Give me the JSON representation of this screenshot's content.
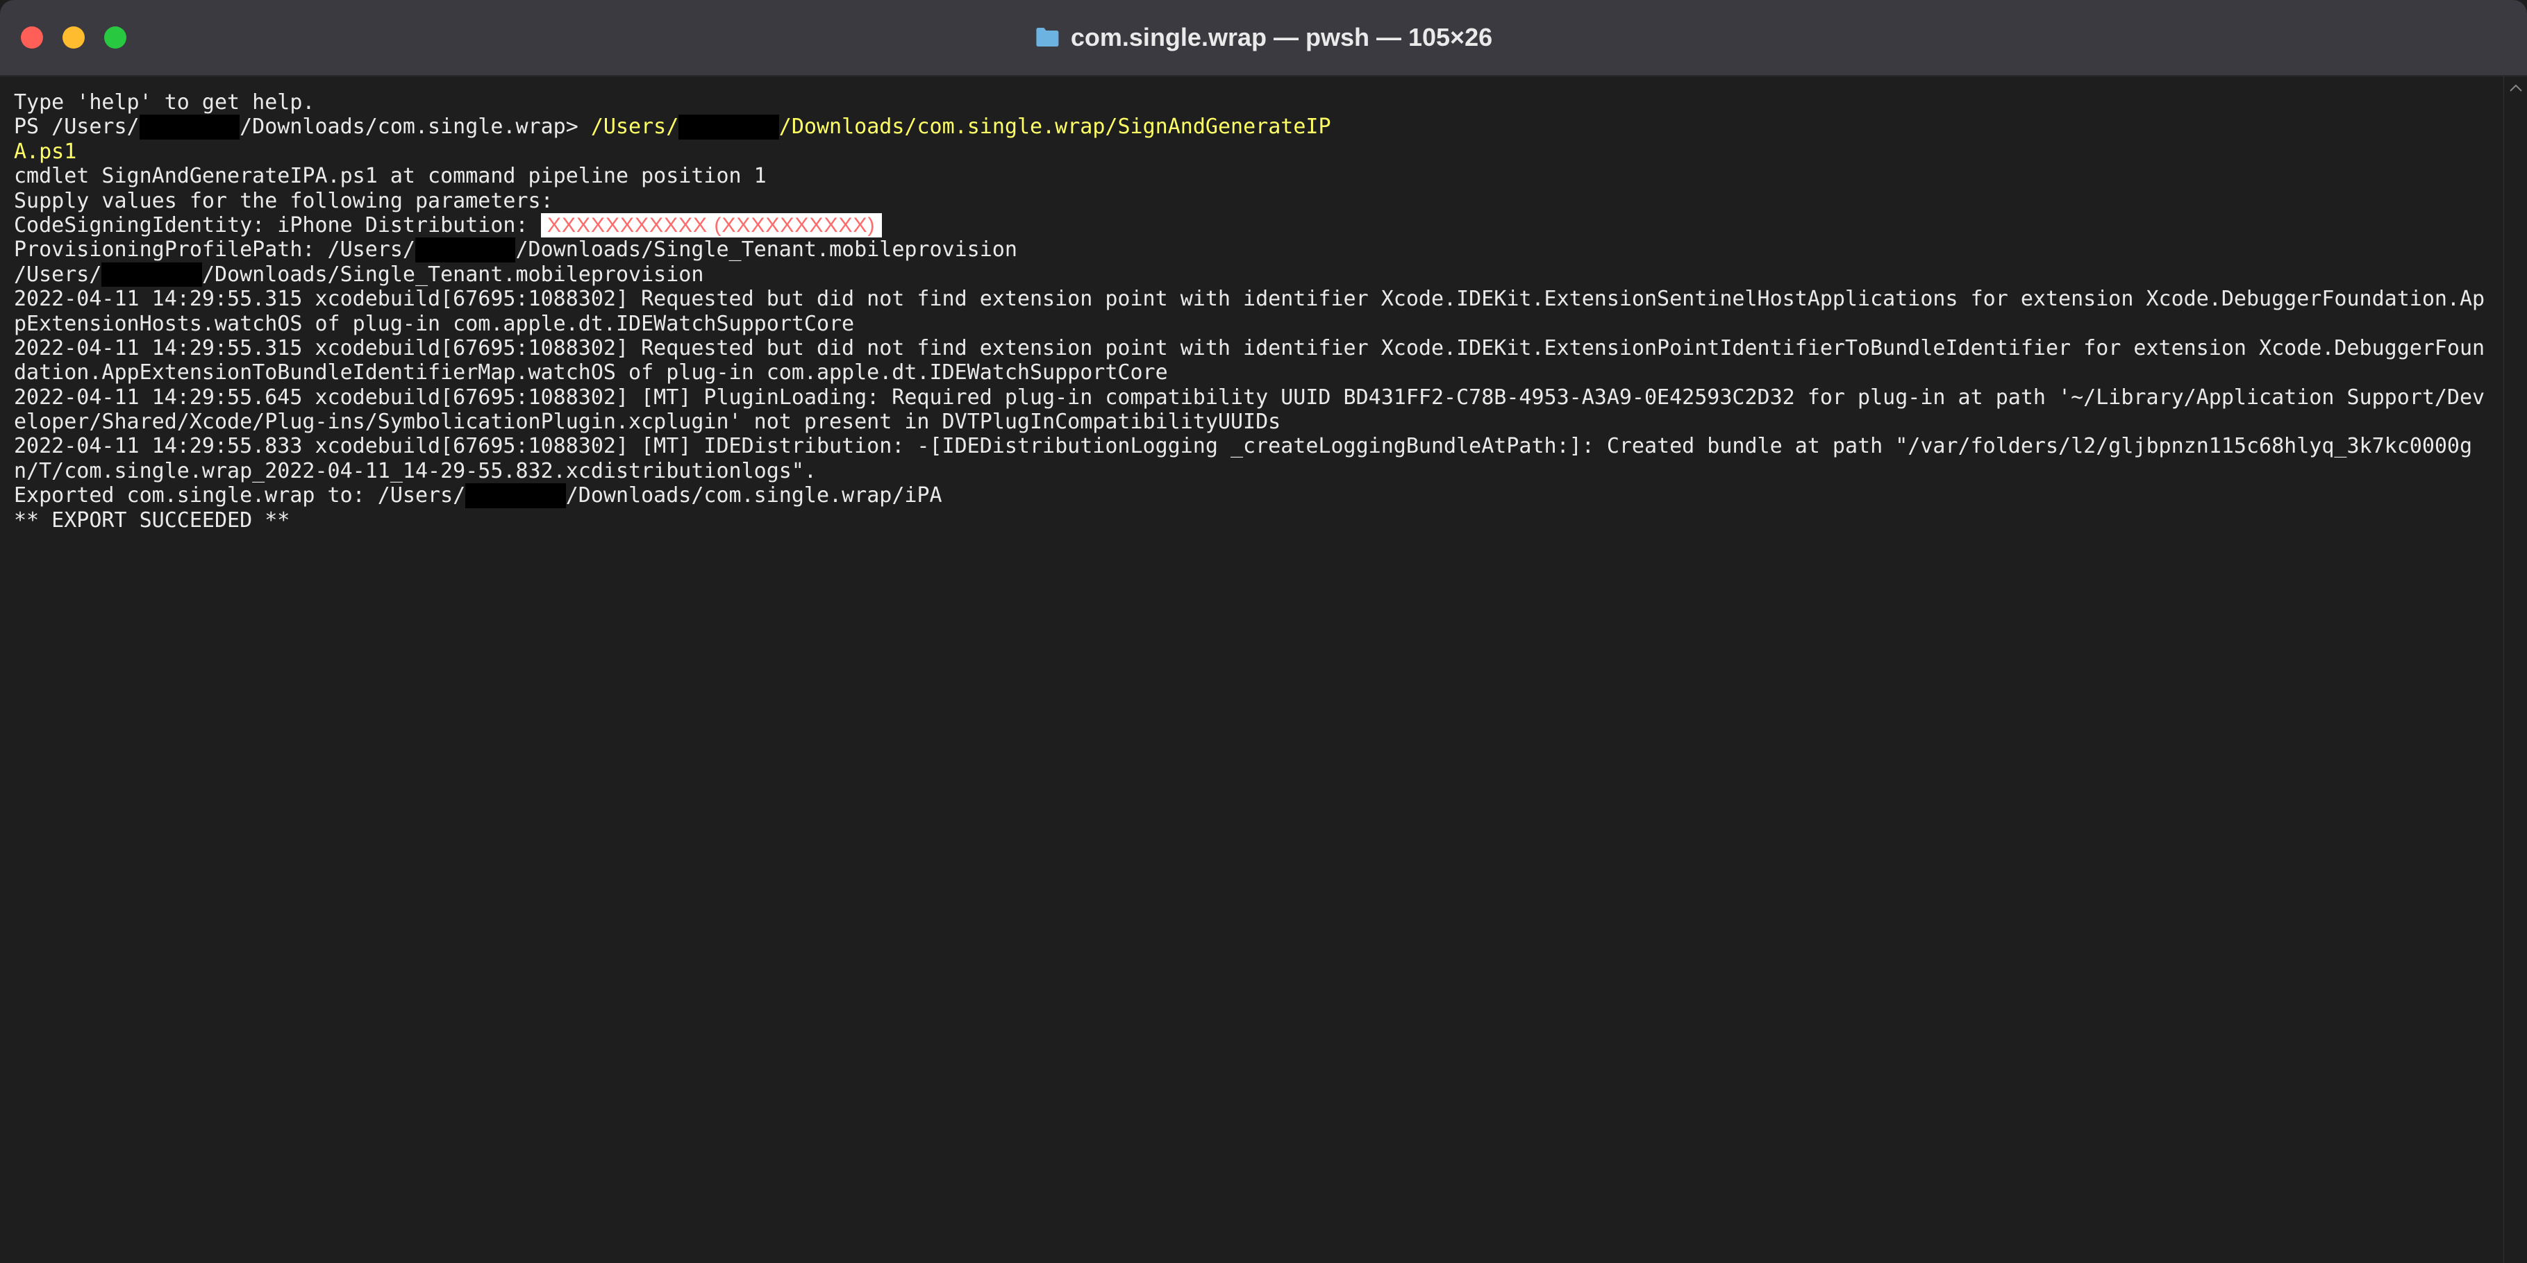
{
  "window": {
    "title": "com.single.wrap — pwsh — 105×26",
    "folder_icon_color": "#6db3e2"
  },
  "terminal": {
    "help_line": "Type 'help' to get help.",
    "prompt_prefix": "PS /Users/",
    "prompt_redacted_width": "        ",
    "prompt_path": "/Downloads/com.single.wrap> ",
    "command_part1": "/Users/",
    "command_redacted": "        ",
    "command_part2": "/Downloads/com.single.wrap/SignAndGenerateIP",
    "command_wrap": "A.ps1",
    "blank": "",
    "cmdlet_line": "cmdlet SignAndGenerateIPA.ps1 at command pipeline position 1",
    "supply_line": "Supply values for the following parameters:",
    "code_sign_label": "CodeSigningIdentity: iPhone Distribution: ",
    "code_sign_redacted": " XXXXXXXXXXX (XXXXXXXXXX) ",
    "prov_label": "ProvisioningProfilePath: /Users/",
    "prov_redacted": "        ",
    "prov_path": "/Downloads/Single_Tenant.mobileprovision",
    "user_path_prefix": "/Users/",
    "user_path_redacted": "        ",
    "user_path_suffix": "/Downloads/Single_Tenant.mobileprovision",
    "log1": "2022-04-11 14:29:55.315 xcodebuild[67695:1088302] Requested but did not find extension point with identifier Xcode.IDEKit.ExtensionSentinelHostApplications for extension Xcode.DebuggerFoundation.AppExtensionHosts.watchOS of plug-in com.apple.dt.IDEWatchSupportCore",
    "log2": "2022-04-11 14:29:55.315 xcodebuild[67695:1088302] Requested but did not find extension point with identifier Xcode.IDEKit.ExtensionPointIdentifierToBundleIdentifier for extension Xcode.DebuggerFoundation.AppExtensionToBundleIdentifierMap.watchOS of plug-in com.apple.dt.IDEWatchSupportCore",
    "log3": "2022-04-11 14:29:55.645 xcodebuild[67695:1088302] [MT] PluginLoading: Required plug-in compatibility UUID BD431FF2-C78B-4953-A3A9-0E42593C2D32 for plug-in at path '~/Library/Application Support/Developer/Shared/Xcode/Plug-ins/SymbolicationPlugin.xcplugin' not present in DVTPlugInCompatibilityUUIDs",
    "log4": "2022-04-11 14:29:55.833 xcodebuild[67695:1088302] [MT] IDEDistribution: -[IDEDistributionLogging _createLoggingBundleAtPath:]: Created bundle at path \"/var/folders/l2/gljbpnzn115c68hlyq_3k7kc0000gn/T/com.single.wrap_2022-04-11_14-29-55.832.xcdistributionlogs\".",
    "export_prefix": "Exported com.single.wrap to: /Users/",
    "export_redacted": "        ",
    "export_suffix": "/Downloads/com.single.wrap/iPA",
    "success": "** EXPORT SUCCEEDED **"
  }
}
